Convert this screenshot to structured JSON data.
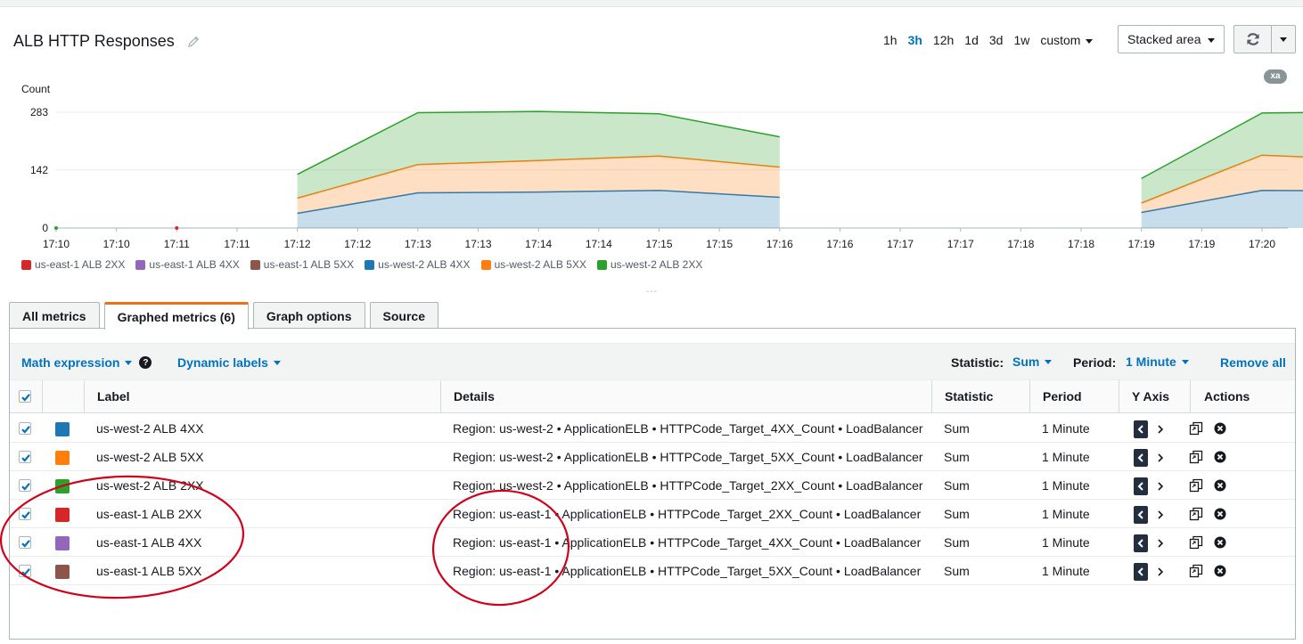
{
  "widget": {
    "title": "ALB HTTP Responses",
    "time_ranges": [
      "1h",
      "3h",
      "12h",
      "1d",
      "3d",
      "1w"
    ],
    "active_range": "3h",
    "custom_label": "custom",
    "chart_type": "Stacked area",
    "badge": "xa",
    "drag_handle": "---"
  },
  "chart_data": {
    "type": "area",
    "stacked": true,
    "ylabel": "Count",
    "yticks": [
      0,
      142,
      283
    ],
    "ylim": [
      0,
      283
    ],
    "x_tick_labels": [
      "17:10",
      "17:10",
      "17:11",
      "17:11",
      "17:12",
      "17:12",
      "17:13",
      "17:13",
      "17:14",
      "17:14",
      "17:15",
      "17:15",
      "17:16",
      "17:16",
      "17:17",
      "17:17",
      "17:18",
      "17:18",
      "17:19",
      "17:19",
      "17:20"
    ],
    "x": [
      "17:10",
      "17:11",
      "17:12",
      "17:13",
      "17:14",
      "17:15",
      "17:16",
      "17:17",
      "17:18",
      "17:19",
      "17:20",
      "17:20:30"
    ],
    "series": [
      {
        "name": "us-west-2 ALB 4XX",
        "color": "#1f77b4",
        "values": [
          0,
          0,
          36,
          86,
          88,
          92,
          75,
          null,
          null,
          38,
          92,
          90
        ]
      },
      {
        "name": "us-west-2 ALB 5XX",
        "color": "#ff7f0e",
        "values": [
          0,
          0,
          37,
          69,
          77,
          84,
          74,
          null,
          null,
          23,
          86,
          76
        ]
      },
      {
        "name": "us-west-2 ALB 2XX",
        "color": "#2ca02c",
        "values": [
          0,
          0,
          58,
          127,
          120,
          103,
          74,
          null,
          null,
          60,
          103,
          118
        ]
      },
      {
        "name": "us-east-1 ALB 2XX",
        "color": "#d62728",
        "values": [
          0,
          0,
          0,
          0,
          0,
          0,
          0,
          0,
          0,
          0,
          0,
          0
        ]
      },
      {
        "name": "us-east-1 ALB 4XX",
        "color": "#9467bd",
        "values": [
          0,
          0,
          0,
          0,
          0,
          0,
          0,
          0,
          0,
          0,
          0,
          0
        ]
      },
      {
        "name": "us-east-1 ALB 5XX",
        "color": "#8c564b",
        "values": [
          0,
          0,
          0,
          0,
          0,
          0,
          0,
          0,
          0,
          0,
          0,
          0
        ]
      }
    ],
    "legend": [
      {
        "label": "us-east-1 ALB 2XX",
        "color": "#d62728"
      },
      {
        "label": "us-east-1 ALB 4XX",
        "color": "#9467bd"
      },
      {
        "label": "us-east-1 ALB 5XX",
        "color": "#8c564b"
      },
      {
        "label": "us-west-2 ALB 4XX",
        "color": "#1f77b4"
      },
      {
        "label": "us-west-2 ALB 5XX",
        "color": "#ff7f0e"
      },
      {
        "label": "us-west-2 ALB 2XX",
        "color": "#2ca02c"
      }
    ]
  },
  "tabs": [
    {
      "label": "All metrics",
      "active": false
    },
    {
      "label": "Graphed metrics (6)",
      "active": true
    },
    {
      "label": "Graph options",
      "active": false
    },
    {
      "label": "Source",
      "active": false
    }
  ],
  "toolbar": {
    "math_expression": "Math expression",
    "dynamic_labels": "Dynamic labels",
    "statistic_label": "Statistic:",
    "statistic_value": "Sum",
    "period_label": "Period:",
    "period_value": "1 Minute",
    "remove_all": "Remove all"
  },
  "table": {
    "columns": {
      "label": "Label",
      "details": "Details",
      "statistic": "Statistic",
      "period": "Period",
      "yaxis": "Y Axis",
      "actions": "Actions"
    },
    "rows": [
      {
        "color": "#1f77b4",
        "label": "us-west-2 ALB 4XX",
        "details": "Region: us-west-2 • ApplicationELB • HTTPCode_Target_4XX_Count • LoadBalancer",
        "statistic": "Sum",
        "period": "1 Minute"
      },
      {
        "color": "#ff7f0e",
        "label": "us-west-2 ALB 5XX",
        "details": "Region: us-west-2 • ApplicationELB • HTTPCode_Target_5XX_Count • LoadBalancer",
        "statistic": "Sum",
        "period": "1 Minute"
      },
      {
        "color": "#2ca02c",
        "label": "us-west-2 ALB 2XX",
        "details": "Region: us-west-2 • ApplicationELB • HTTPCode_Target_2XX_Count • LoadBalancer",
        "statistic": "Sum",
        "period": "1 Minute"
      },
      {
        "color": "#d62728",
        "label": "us-east-1 ALB 2XX",
        "details": "Region: us-east-1 • ApplicationELB • HTTPCode_Target_2XX_Count • LoadBalancer",
        "statistic": "Sum",
        "period": "1 Minute"
      },
      {
        "color": "#9467bd",
        "label": "us-east-1 ALB 4XX",
        "details": "Region: us-east-1 • ApplicationELB • HTTPCode_Target_4XX_Count • LoadBalancer",
        "statistic": "Sum",
        "period": "1 Minute"
      },
      {
        "color": "#8c564b",
        "label": "us-east-1 ALB 5XX",
        "details": "Region: us-east-1 • ApplicationELB • HTTPCode_Target_5XX_Count • LoadBalancer",
        "statistic": "Sum",
        "period": "1 Minute"
      }
    ]
  },
  "annotation_color": "#d0021b"
}
